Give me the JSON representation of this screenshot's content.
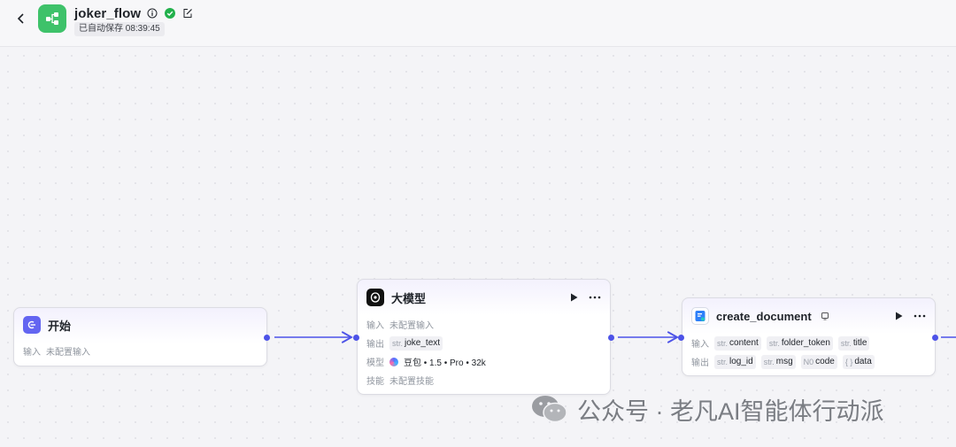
{
  "header": {
    "title": "joker_flow",
    "save_status": "已自动保存 08:39:45"
  },
  "nodes": {
    "start": {
      "title": "开始",
      "input_label": "输入",
      "input_value": "未配置输入"
    },
    "llm": {
      "title": "大模型",
      "input_label": "输入",
      "input_value": "未配置输入",
      "output_label": "输出",
      "output_type": "str.",
      "output_name": "joke_text",
      "model_label": "模型",
      "model_value": "豆包 • 1.5 • Pro • 32k",
      "skill_label": "技能",
      "skill_value": "未配置技能"
    },
    "create_document": {
      "title": "create_document",
      "input_label": "输入",
      "inputs": [
        {
          "type": "str.",
          "name": "content"
        },
        {
          "type": "str.",
          "name": "folder_token"
        },
        {
          "type": "str.",
          "name": "title"
        }
      ],
      "output_label": "输出",
      "outputs": [
        {
          "type": "str.",
          "name": "log_id"
        },
        {
          "type": "str.",
          "name": "msg"
        },
        {
          "type": "N0",
          "name": "code"
        },
        {
          "type": "{ }",
          "name": "data"
        }
      ]
    }
  },
  "watermark": {
    "text": "公众号 · 老凡AI智能体行动派"
  },
  "colors": {
    "accent": "#4d53e8",
    "app_icon": "#3ec26a",
    "status_ok": "#22b14c"
  },
  "icons": [
    "back-icon",
    "workflow-icon",
    "info-icon",
    "check-circle-icon",
    "edit-icon",
    "start-icon",
    "llm-icon",
    "doc-icon",
    "run-icon",
    "more-icon",
    "wechat-icon"
  ]
}
